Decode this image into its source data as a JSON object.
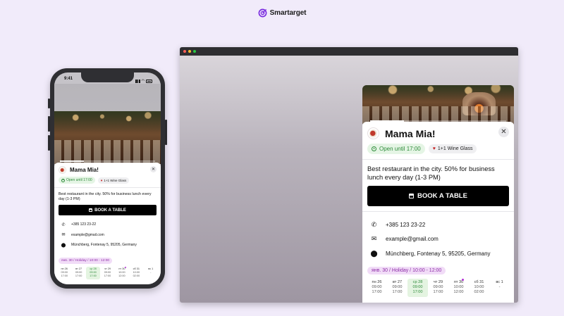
{
  "brand": {
    "name": "Smartarget",
    "color": "#7b2ee0"
  },
  "phone": {
    "time": "9:41"
  },
  "widget": {
    "title": "Mama Mia!",
    "open_status": "Open until 17:00",
    "promo": "1+1 Wine Glass",
    "description": "Best restaurant in the city. 50% for business lunch every day (1-3 PM)",
    "book_label": "BOOK A TABLE",
    "phone": "+385 123 23-22",
    "email": "example@gmail.com",
    "address": "Münchberg, Fontenay 5, 95205, Germany",
    "holiday": "янв. 30 / Holiday / 10:00 - 12:00",
    "slider_progress": 0.25,
    "days": [
      {
        "name": "пн 26",
        "open": "09:00",
        "close": "17:00"
      },
      {
        "name": "вт 27",
        "open": "09:00",
        "close": "17:00"
      },
      {
        "name": "ср 28",
        "open": "09:00",
        "close": "17:00"
      },
      {
        "name": "чт 29",
        "open": "09:00",
        "close": "17:00"
      },
      {
        "name": "пт 30",
        "open": "10:00",
        "close": "12:00"
      },
      {
        "name": "сб 31",
        "open": "10:00",
        "close": "02:00"
      },
      {
        "name": "вс 1",
        "open": "-",
        "close": ""
      }
    ]
  },
  "colors": {
    "open_green": "#2e8b3a",
    "holiday_purple": "#8e2fa8",
    "button_black": "#000000",
    "page_background": "#f1ebfa"
  },
  "icons": [
    "logo-target-icon",
    "clock-icon",
    "heart-icon",
    "close-icon",
    "calendar-icon",
    "phone-icon",
    "mail-icon",
    "location-pin-icon"
  ]
}
